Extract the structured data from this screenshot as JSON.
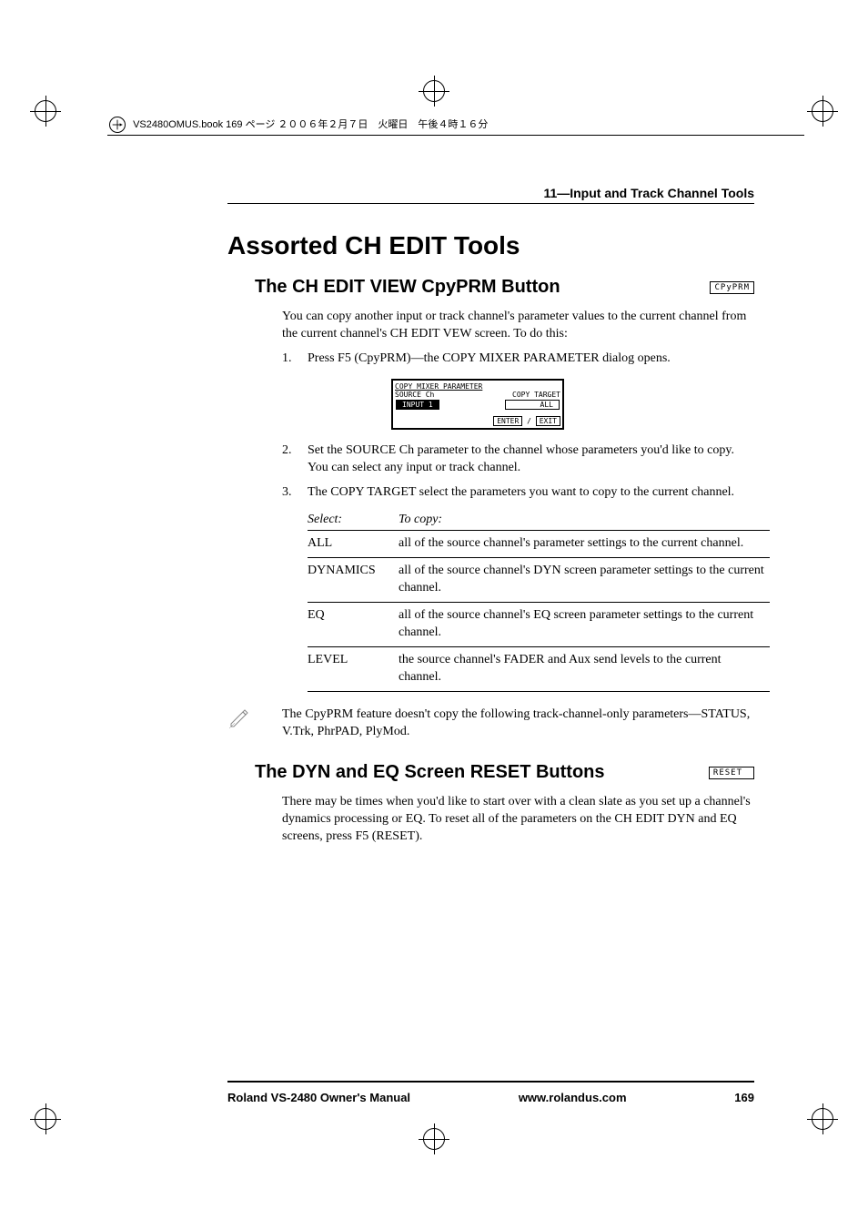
{
  "bookHeader": "VS2480OMUS.book 169 ページ ２００６年２月７日　火曜日　午後４時１６分",
  "chapterHeader": "11—Input and Track Channel Tools",
  "h1": "Assorted CH EDIT Tools",
  "section1": {
    "heading": "The CH EDIT VIEW CpyPRM Button",
    "buttonLabel": "CPyPRM",
    "intro": "You can copy another input or track channel's parameter values to the current channel from the current channel's CH EDIT VEW screen. To do this:",
    "step1": "Press F5 (CpyPRM)—the COPY MIXER PARAMETER dialog opens.",
    "dialog": {
      "title": "COPY MIXER PARAMETER",
      "sourceLabel": "SOURCE Ch",
      "targetLabel": "COPY TARGET",
      "sourceValue": "INPUT  1",
      "targetValue": "ALL",
      "enter": "ENTER",
      "exit": "EXIT"
    },
    "step2": "Set the SOURCE Ch parameter to the channel whose parameters you'd like to copy. You can select any input or track channel.",
    "step3": "The COPY TARGET select the parameters you want to copy to the current channel.",
    "table": {
      "header1": "Select:",
      "header2": "To copy:",
      "rows": [
        {
          "k": "ALL",
          "v": "all of the source channel's parameter settings to the current channel."
        },
        {
          "k": "DYNAMICS",
          "v": "all of the source channel's DYN screen parameter settings to the current channel."
        },
        {
          "k": "EQ",
          "v": "all of the source channel's EQ screen parameter settings to the current channel."
        },
        {
          "k": "LEVEL",
          "v": "the source channel's FADER and Aux send levels to the current channel."
        }
      ]
    },
    "note": "The CpyPRM feature doesn't copy the following track-channel-only parameters—STATUS, V.Trk, PhrPAD, PlyMod."
  },
  "section2": {
    "heading": "The DYN and EQ Screen RESET Buttons",
    "buttonLabel": "RESET",
    "body": "There may be times when you'd like to start over with a clean slate as you set up a channel's dynamics processing or EQ. To reset all of the parameters on the CH EDIT DYN and EQ screens, press F5 (RESET)."
  },
  "footer": {
    "left": "Roland VS-2480 Owner's Manual",
    "center": "www.rolandus.com",
    "right": "169"
  }
}
